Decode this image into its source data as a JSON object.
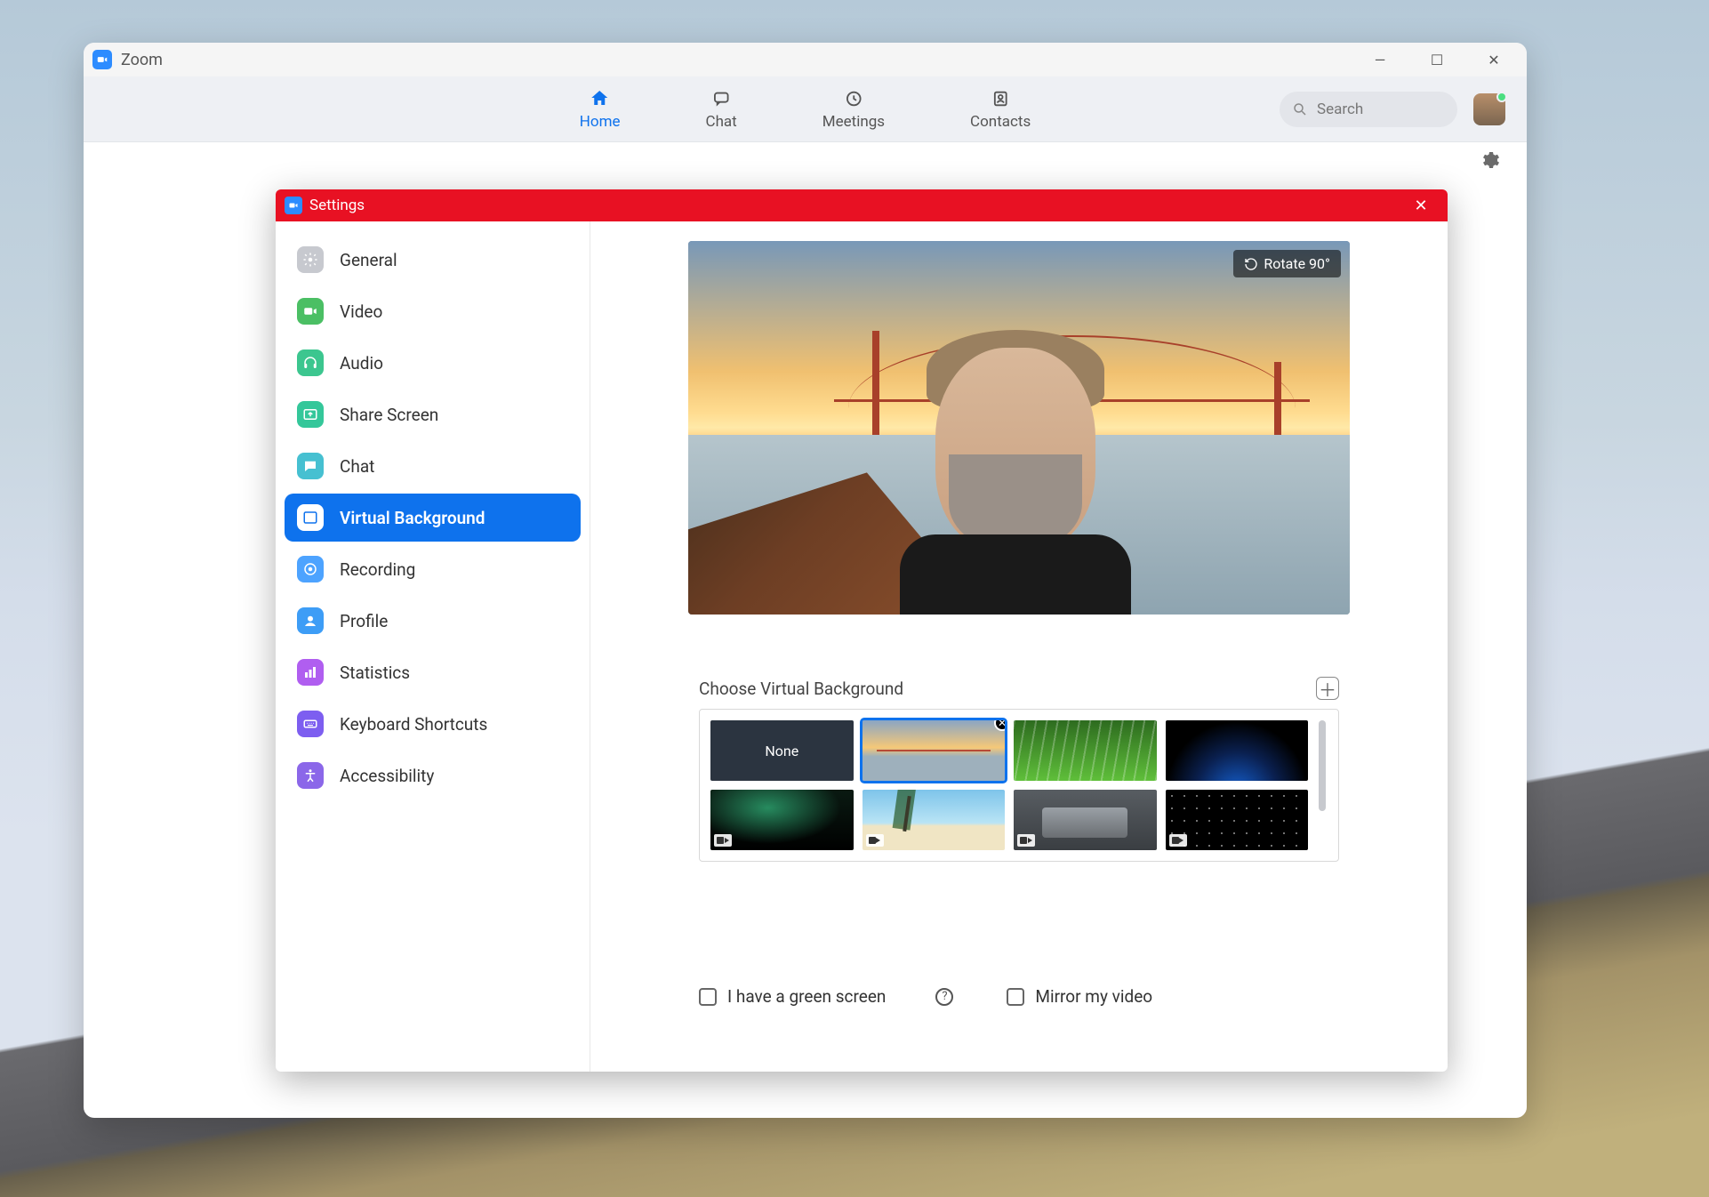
{
  "app": {
    "title": "Zoom"
  },
  "nav": {
    "home": "Home",
    "chat": "Chat",
    "meetings": "Meetings",
    "contacts": "Contacts",
    "active": "home"
  },
  "search": {
    "placeholder": "Search"
  },
  "settings": {
    "title": "Settings",
    "sidebar": {
      "general": "General",
      "video": "Video",
      "audio": "Audio",
      "share_screen": "Share Screen",
      "chat": "Chat",
      "virtual_background": "Virtual Background",
      "recording": "Recording",
      "profile": "Profile",
      "statistics": "Statistics",
      "keyboard_shortcuts": "Keyboard Shortcuts",
      "accessibility": "Accessibility",
      "selected": "virtual_background"
    },
    "preview": {
      "rotate_label": "Rotate 90°"
    },
    "backgrounds": {
      "choose_label": "Choose Virtual Background",
      "none_label": "None",
      "selected_index": 1,
      "items": [
        {
          "id": "none",
          "kind": "none"
        },
        {
          "id": "bridge",
          "kind": "image"
        },
        {
          "id": "grass",
          "kind": "image"
        },
        {
          "id": "earth",
          "kind": "image"
        },
        {
          "id": "aurora",
          "kind": "video"
        },
        {
          "id": "beach",
          "kind": "video"
        },
        {
          "id": "hangar",
          "kind": "video"
        },
        {
          "id": "stars",
          "kind": "video"
        }
      ]
    },
    "options": {
      "green_screen": "I have a green screen",
      "mirror_video": "Mirror my video"
    }
  }
}
